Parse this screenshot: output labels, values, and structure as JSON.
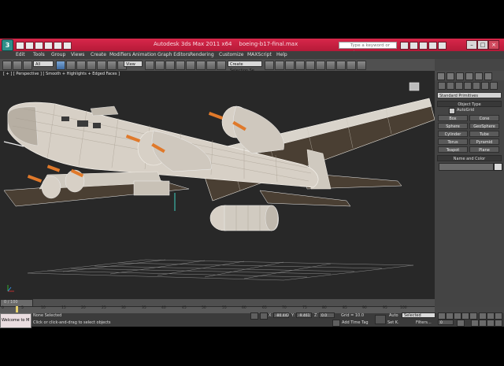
{
  "window": {
    "title": "Autodesk 3ds Max 2011 x64",
    "file": "boeing-b17-final.max",
    "search_placeholder": "Type a keyword or phrase"
  },
  "menu": [
    "Edit",
    "Tools",
    "Group",
    "Views",
    "Create",
    "Modifiers",
    "Animation",
    "Graph Editors",
    "Rendering",
    "Customize",
    "MAXScript",
    "Help"
  ],
  "toolbar": {
    "filter_value": "All",
    "view_value": "View",
    "named_selection_placeholder": "Create Selection Se"
  },
  "viewport": {
    "label": "[ + ] [ Perspective ] [ Smooth + Highlights + Edged Faces ]"
  },
  "command_panel": {
    "category": "Standard Primitives",
    "object_type_title": "Object Type",
    "autogrid_label": "AutoGrid",
    "buttons": [
      "Box",
      "Cone",
      "Sphere",
      "GeoSphere",
      "Cylinder",
      "Tube",
      "Torus",
      "Pyramid",
      "Teapot",
      "Plane"
    ],
    "name_color_title": "Name and Color"
  },
  "time_slider": {
    "label": "0 / 100"
  },
  "trackbar": {
    "ticks": [
      "0",
      "5",
      "10",
      "15",
      "20",
      "25",
      "30",
      "35",
      "40",
      "45",
      "50",
      "55",
      "60",
      "65",
      "70",
      "75",
      "80",
      "85",
      "90",
      "95",
      "100"
    ]
  },
  "status": {
    "maxscript_text": "Welcome to M",
    "selection_status": "None Selected",
    "prompt": "Click or click-and-drag to select objects",
    "x_label": "X:",
    "x_value": "-80.442",
    "y_label": "Y:",
    "y_value": "-9.461",
    "z_label": "Z:",
    "z_value": "0.0",
    "grid": "Grid = 10.0",
    "auto_key": "Auto",
    "set_key": "Set K.",
    "selected_value": "Selected",
    "filters": "Filters...",
    "add_time_tag": "Add Time Tag",
    "frame": "0"
  }
}
